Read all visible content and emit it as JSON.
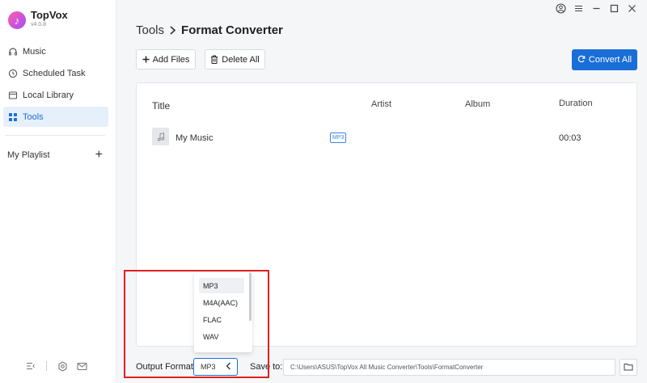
{
  "app": {
    "name": "TopVox",
    "version": "v4.0.8"
  },
  "sidebar": {
    "items": [
      {
        "label": "Music",
        "icon": "headphones-icon"
      },
      {
        "label": "Scheduled Task",
        "icon": "clock-icon"
      },
      {
        "label": "Local Library",
        "icon": "library-icon"
      },
      {
        "label": "Tools",
        "icon": "grid-icon",
        "active": true
      }
    ],
    "playlist_label": "My Playlist"
  },
  "breadcrumb": {
    "parent": "Tools",
    "current": "Format Converter"
  },
  "toolbar": {
    "add_files": "Add Files",
    "delete_all": "Delete All",
    "convert_all": "Convert All"
  },
  "table": {
    "headers": {
      "title": "Title",
      "artist": "Artist",
      "album": "Album",
      "duration": "Duration"
    },
    "rows": [
      {
        "title": "My Music",
        "format": "MP3",
        "artist": "",
        "album": "",
        "duration": "00:03"
      }
    ]
  },
  "bottom": {
    "output_label": "Output Format:",
    "output_value": "MP3",
    "save_label": "Save to:",
    "save_path": "C:\\Users\\ASUS\\TopVox All Music Converter\\Tools\\FormatConverter"
  },
  "dropdown": {
    "options": [
      "MP3",
      "M4A(AAC)",
      "FLAC",
      "WAV"
    ],
    "selected": "MP3"
  },
  "colors": {
    "accent": "#1a6ed8",
    "highlight": "#e02020",
    "active_bg": "#e6f0fb"
  }
}
